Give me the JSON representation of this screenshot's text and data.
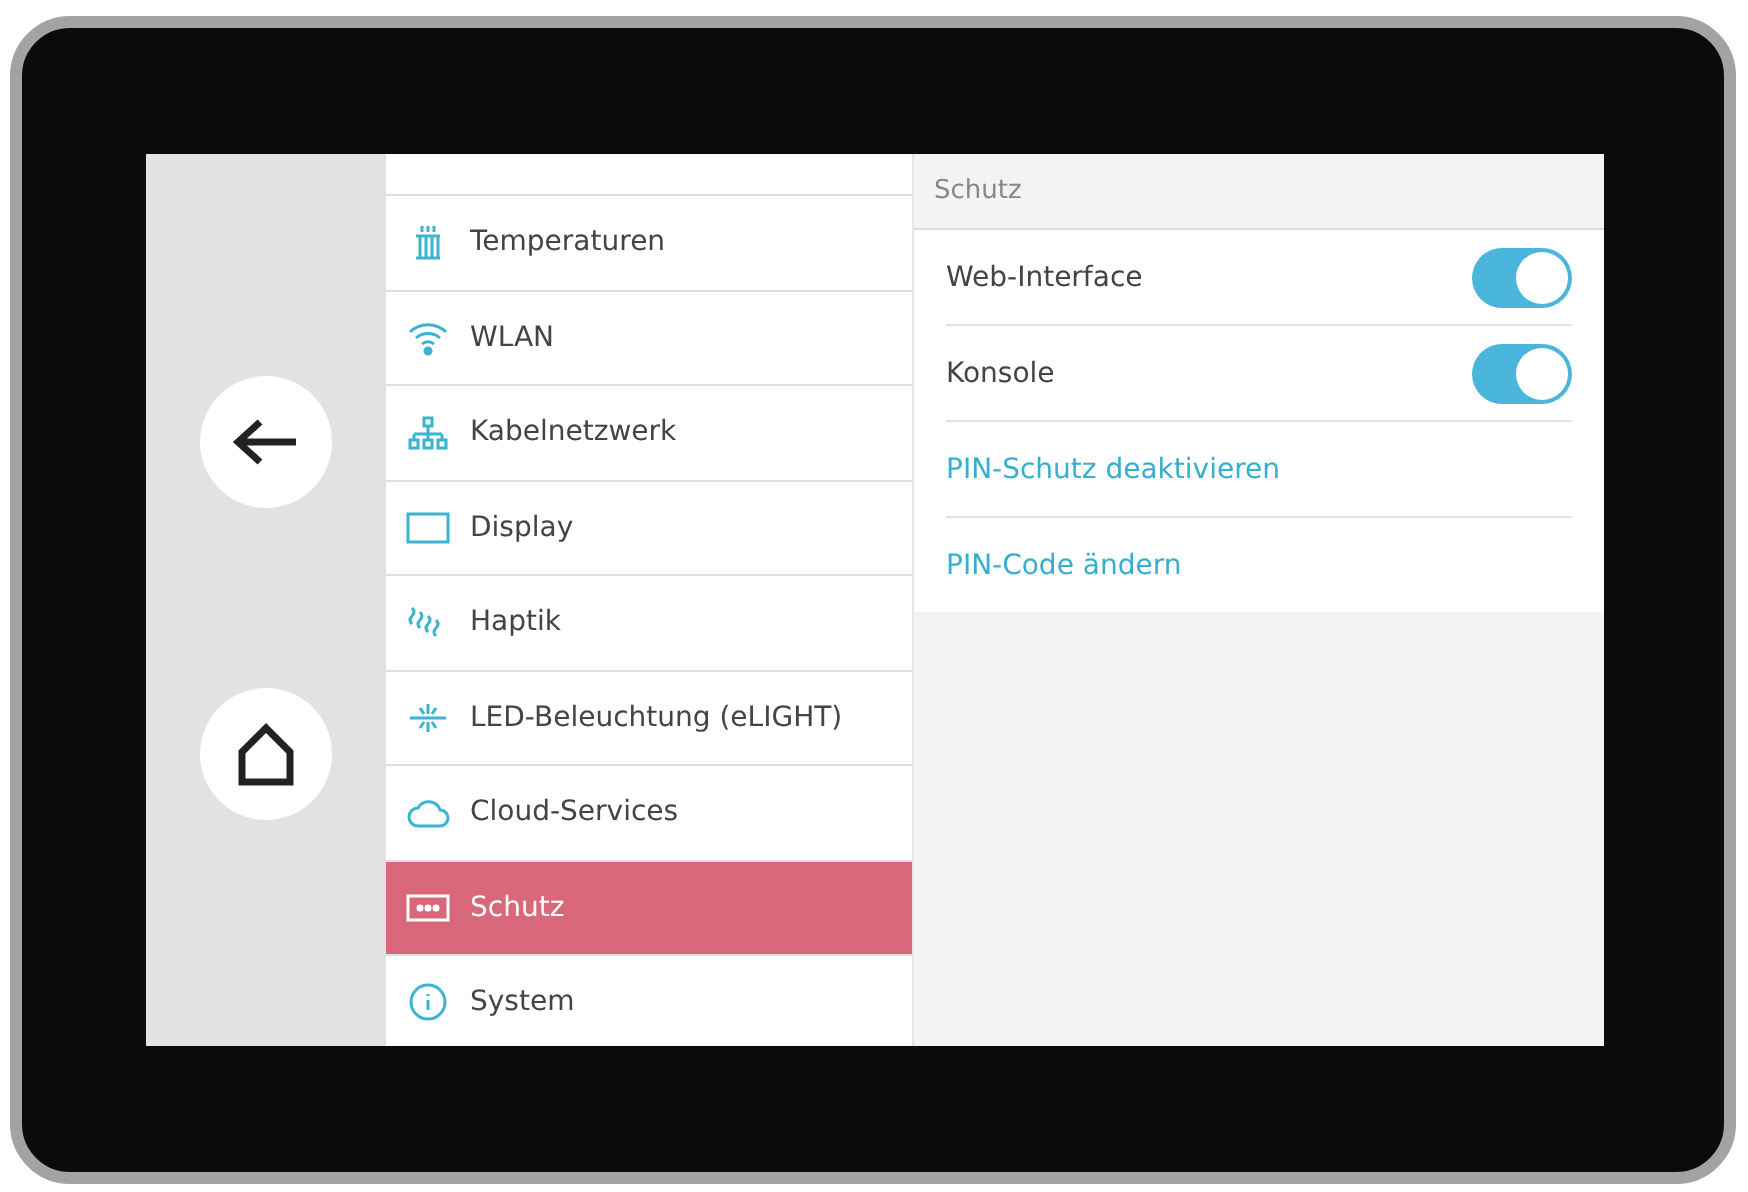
{
  "nav_buttons": [
    {
      "kind": "back"
    },
    {
      "kind": "home"
    }
  ],
  "menu": {
    "items": [
      {
        "label": "Temperaturen",
        "kind": "radiator",
        "selected": false
      },
      {
        "label": "WLAN",
        "kind": "wifi",
        "selected": false
      },
      {
        "label": "Kabelnetzwerk",
        "kind": "network",
        "selected": false
      },
      {
        "label": "Display",
        "kind": "display",
        "selected": false
      },
      {
        "label": "Haptik",
        "kind": "haptic",
        "selected": false
      },
      {
        "label": "LED-Beleuchtung (eLIGHT)",
        "kind": "light",
        "selected": false
      },
      {
        "label": "Cloud-Services",
        "kind": "cloud",
        "selected": false
      },
      {
        "label": "Schutz",
        "kind": "pin",
        "selected": true
      },
      {
        "label": "System",
        "kind": "info",
        "selected": false
      }
    ]
  },
  "panel": {
    "title": "Schutz",
    "rows": [
      {
        "kind": "toggle",
        "label": "Web-Interface",
        "on": true
      },
      {
        "kind": "toggle",
        "label": "Konsole",
        "on": true
      },
      {
        "kind": "link",
        "label": "PIN-Schutz deaktivieren"
      },
      {
        "kind": "link",
        "label": "PIN-Code ändern"
      }
    ]
  }
}
